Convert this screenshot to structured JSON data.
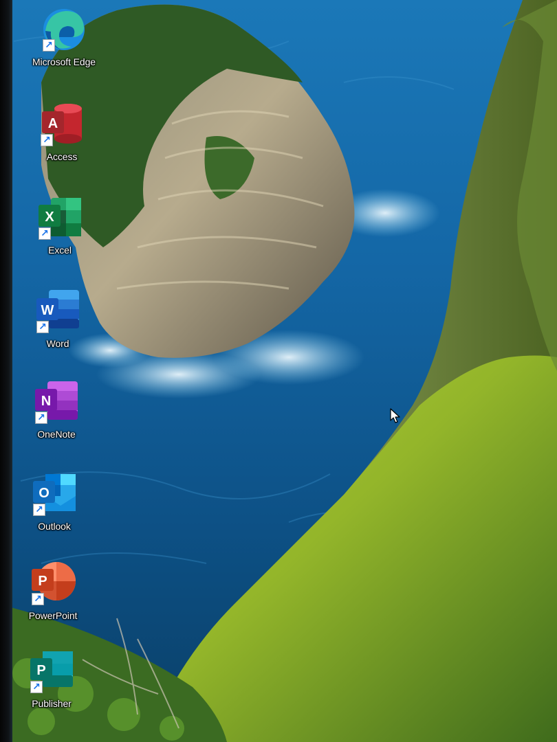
{
  "desktop": {
    "icons": [
      {
        "label": "Microsoft Edge",
        "icon": "edge-icon"
      },
      {
        "label": "Access",
        "icon": "access-icon",
        "letter": "A"
      },
      {
        "label": "Excel",
        "icon": "excel-icon",
        "letter": "X"
      },
      {
        "label": "Word",
        "icon": "word-icon",
        "letter": "W"
      },
      {
        "label": "OneNote",
        "icon": "onenote-icon",
        "letter": "N"
      },
      {
        "label": "Outlook",
        "icon": "outlook-icon",
        "letter": "O"
      },
      {
        "label": "PowerPoint",
        "icon": "powerpoint-icon",
        "letter": "P"
      },
      {
        "label": "Publisher",
        "icon": "publisher-icon",
        "letter": "P"
      }
    ],
    "shortcut_glyph": "↗"
  },
  "colors": {
    "ocean": "#0d4f86",
    "cliff_green": "#8fb42c",
    "edge_blue": "#1b8de0",
    "access_red": "#c4262e",
    "excel_green": "#107c41",
    "word_blue": "#185abd",
    "onenote_purple": "#7719aa",
    "outlook_blue": "#0f6cbd",
    "powerpoint_orange": "#d35230",
    "publisher_teal": "#077568"
  }
}
